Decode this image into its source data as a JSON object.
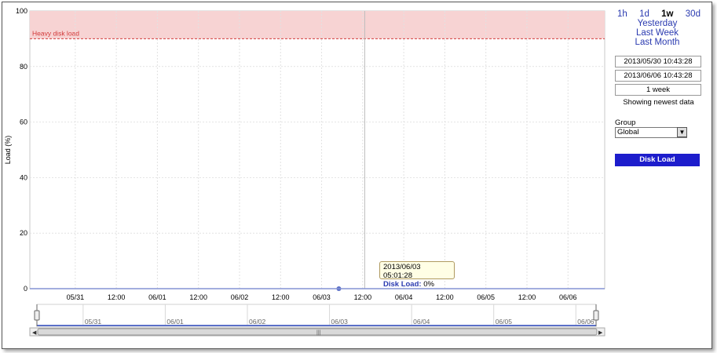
{
  "chart_data": {
    "type": "line",
    "ylabel": "Load (%)",
    "ylim": [
      0,
      100
    ],
    "yticks": [
      "0",
      "20",
      "40",
      "60",
      "80",
      "100"
    ],
    "xlim": [
      "2013/05/30 10:43:28",
      "2013/06/06 10:43:28"
    ],
    "xticks": [
      "05/31",
      "12:00",
      "06/01",
      "12:00",
      "06/02",
      "12:00",
      "06/03",
      "12:00",
      "06/04",
      "12:00",
      "06/05",
      "12:00",
      "06/06"
    ],
    "navigator_labels": [
      "05/31",
      "06/01",
      "06/02",
      "06/03",
      "06/04",
      "06/05",
      "06/06"
    ],
    "series": [
      {
        "x": [
          "2013/05/30 10:43:28",
          "2013/06/06 10:43:28"
        ],
        "values": [
          0,
          0
        ]
      }
    ],
    "threshold": {
      "label": "Heavy disk load",
      "from": 90,
      "to": 100
    },
    "colors": {
      "line": "#5b70c8",
      "threshold": "#d23a3a",
      "threshold_fill": "#f7d3d3",
      "grid": "#e2e2e2"
    },
    "grid": true,
    "navigator": true,
    "highlight_point": {
      "x": "2013/06/03 05:01:28",
      "y": 0
    }
  },
  "tooltip": {
    "timestamp": "2013/06/03 05:01:28",
    "series_label": "Disk Load:",
    "value": "0%"
  },
  "sidebar": {
    "ranges": [
      "1h",
      "1d",
      "1w",
      "30d"
    ],
    "active_range": "1w",
    "links": [
      "Yesterday",
      "Last Week",
      "Last Month"
    ],
    "start": "2013/05/30 10:43:28",
    "end": "2013/06/06 10:43:28",
    "duration": "1 week",
    "status": "Showing newest data",
    "group_label": "Group",
    "group_value": "Global",
    "metric_button": "Disk Load"
  }
}
